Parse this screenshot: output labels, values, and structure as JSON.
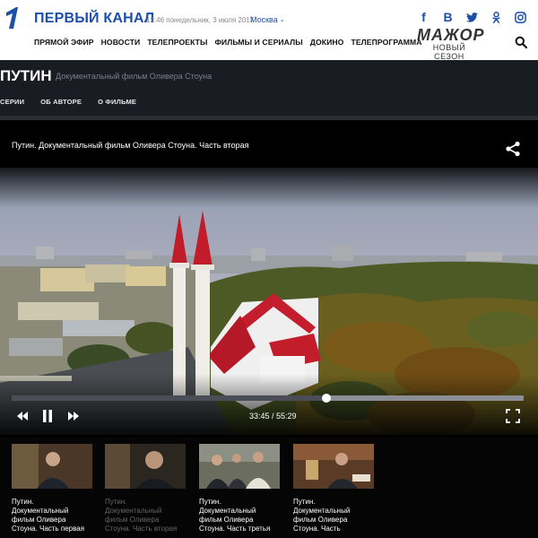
{
  "header": {
    "brand": "ПЕРВЫЙ КАНАЛ",
    "datetime": "12:46 понедельник, 3 июля 2017",
    "city": "Москва",
    "nav": [
      "ПРЯМОЙ ЭФИР",
      "НОВОСТИ",
      "ТЕЛЕПРОЕКТЫ",
      "ФИЛЬМЫ И СЕРИАЛЫ",
      "ДОКИНО",
      "ТЕЛЕПРОГРАММА"
    ],
    "promo": {
      "title": "МАЖОР",
      "subtitle": "НОВЫЙ СЕЗОН"
    },
    "socials": [
      "facebook-icon",
      "vk-icon",
      "twitter-icon",
      "odnoklassniki-icon",
      "instagram-icon"
    ]
  },
  "project": {
    "title": "ПУТИН",
    "subtitle": "Документальный фильм Оливера Стоуна",
    "tabs": [
      "СЕРИИ",
      "ОБ АВТОРЕ",
      "О ФИЛЬМЕ"
    ]
  },
  "player": {
    "title": "Путин. Документальный фильм Оливера Стоуна. Часть вторая",
    "time": "33:45 / 55:29",
    "progress": 0.615
  },
  "thumbnails": [
    {
      "caption": "Путин. Документальный фильм Оливера Стоуна. Часть первая",
      "line1": "Путин.",
      "line2": "Документальный",
      "line3": "фильм Оливера",
      "line4": "Стоуна. Часть первая"
    },
    {
      "caption": "Путин. Документальный фильм Оливера Стоуна. Часть вторая",
      "line1": "Путин.",
      "line2": "Документальный",
      "line3": "фильм Оливера",
      "line4": "Стоуна. Часть вторая"
    },
    {
      "caption": "Путин. Документальный фильм Оливера Стоуна. Часть третья",
      "line1": "Путин.",
      "line2": "Документальный",
      "line3": "фильм Оливера",
      "line4": "Стоуна. Часть третья"
    },
    {
      "caption": "Путин. Документальный фильм Оливера",
      "line1": "Путин.",
      "line2": "Документальный",
      "line3": "фильм Оливера",
      "line4": "Стоуна. Часть"
    }
  ],
  "colors": {
    "brand": "#1e4fa8",
    "dark_bar": "#191c22"
  }
}
